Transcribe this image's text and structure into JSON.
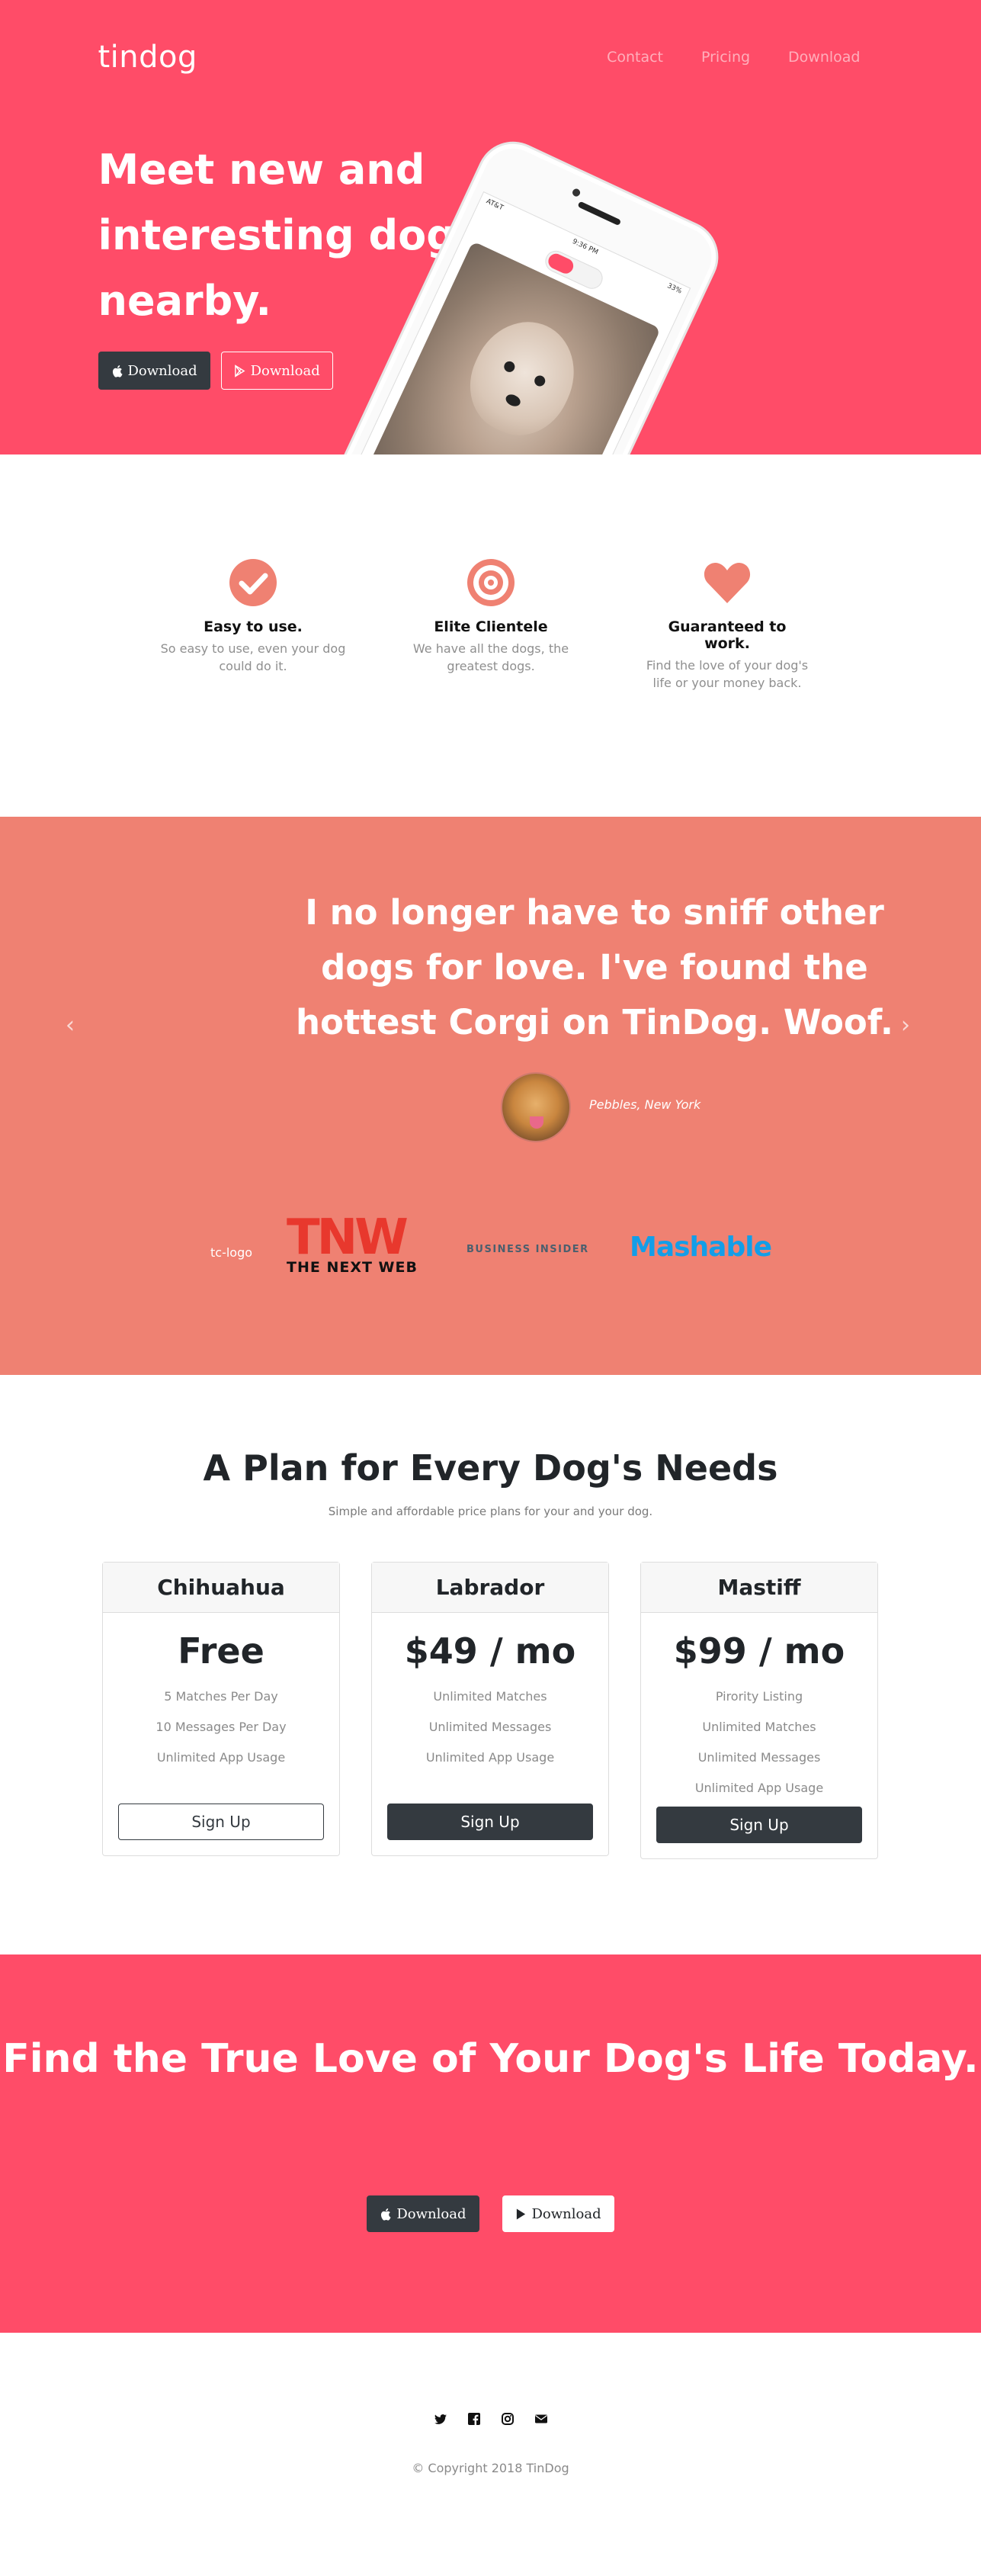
{
  "nav": {
    "brand": "tindog",
    "links": [
      "Contact",
      "Pricing",
      "Download"
    ]
  },
  "hero": {
    "title": "Meet new and interesting dogs nearby.",
    "btn_apple": "Download",
    "btn_google": "Download",
    "phone_status_left": "AT&T",
    "phone_status_time": "9:36 PM",
    "phone_status_right": "33%"
  },
  "features": [
    {
      "icon": "check-circle-icon",
      "title": "Easy to use.",
      "text": "So easy to use, even your dog could do it."
    },
    {
      "icon": "bullseye-icon",
      "title": "Elite Clientele",
      "text": "We have all the dogs, the greatest dogs."
    },
    {
      "icon": "heart-icon",
      "title": "Guaranteed to work.",
      "text": "Find the love of your dog's life or your money back."
    }
  ],
  "testimonial": {
    "quote": "I no longer have to sniff other dogs for love. I've found the hottest Corgi on TinDog. Woof.",
    "caption": "Pebbles, New York"
  },
  "press": {
    "tc": "tc-logo",
    "tnw_mark": "TNW",
    "tnw_text": "THE NEXT WEB",
    "bi": "BUSINESS INSIDER",
    "mashable": "Mashable"
  },
  "pricing": {
    "title": "A Plan for Every Dog's Needs",
    "subtitle": "Simple and affordable price plans for your and your dog.",
    "plans": [
      {
        "name": "Chihuahua",
        "price": "Free",
        "features": [
          "5 Matches Per Day",
          "10 Messages Per Day",
          "Unlimited App Usage"
        ],
        "button": "Sign Up"
      },
      {
        "name": "Labrador",
        "price": "$49 / mo",
        "features": [
          "Unlimited Matches",
          "Unlimited Messages",
          "Unlimited App Usage"
        ],
        "button": "Sign Up"
      },
      {
        "name": "Mastiff",
        "price": "$99 / mo",
        "features": [
          "Pirority Listing",
          "Unlimited Matches",
          "Unlimited Messages",
          "Unlimited App Usage"
        ],
        "button": "Sign Up"
      }
    ]
  },
  "cta": {
    "title": "Find the True Love of Your Dog's Life Today.",
    "btn_apple": "Download",
    "btn_google": "Download"
  },
  "footer": {
    "social": [
      "twitter-icon",
      "facebook-icon",
      "instagram-icon",
      "envelope-icon"
    ],
    "copyright": "© Copyright 2018 TinDog"
  },
  "colors": {
    "brand_red": "#ff4c68",
    "salmon": "#ef8172",
    "dark": "#343a40"
  }
}
